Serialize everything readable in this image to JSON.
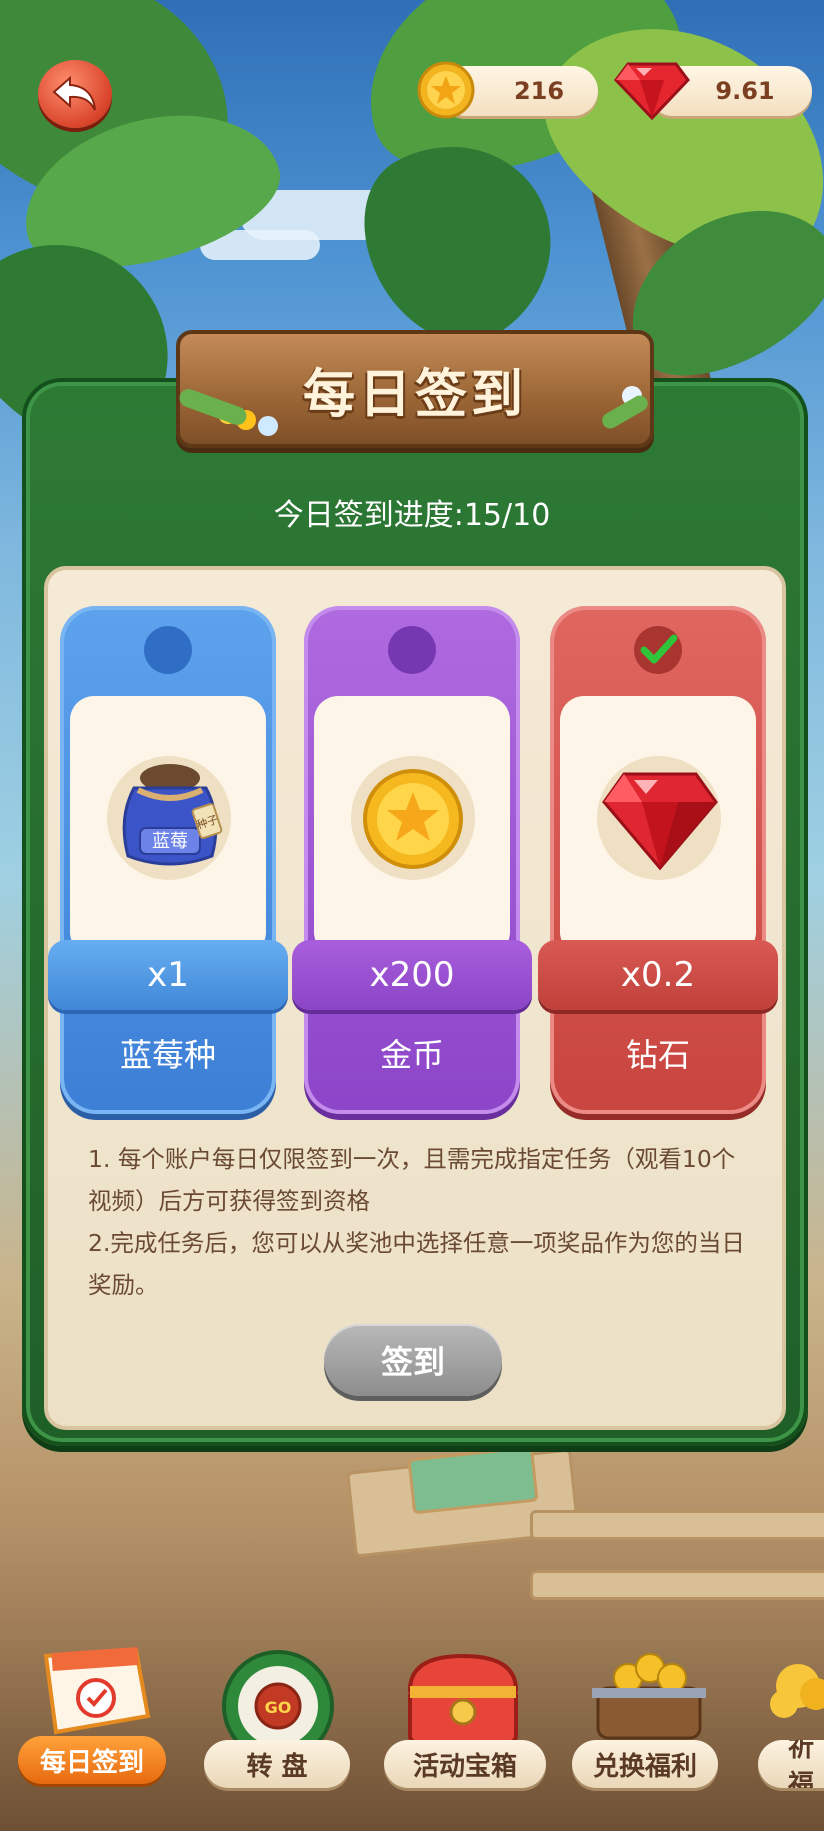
{
  "header": {
    "coins": "216",
    "diamonds": "9.61"
  },
  "panel": {
    "title": "每日签到",
    "progress": "今日签到进度:15/10"
  },
  "rewards": [
    {
      "amount": "x1",
      "name": "蓝莓种",
      "bag_label": "蓝莓",
      "tag": "种子",
      "checked": false,
      "color": "#4a8fe0"
    },
    {
      "amount": "x200",
      "name": "金币",
      "checked": false,
      "color": "#9e57d6"
    },
    {
      "amount": "x0.2",
      "name": "钻石",
      "checked": true,
      "color": "#d4534d"
    }
  ],
  "rules": [
    "1. 每个账户每日仅限签到一次，且需完成指定任务（观看10个视频）后方可获得签到资格",
    "2.完成任务后，您可以从奖池中选择任意一项奖品作为您的当日奖励。"
  ],
  "sign_button": "签到",
  "nav": {
    "items": [
      {
        "label": "每日签到",
        "active": true
      },
      {
        "label": "转 盘",
        "badge": "GO"
      },
      {
        "label": "活动宝箱"
      },
      {
        "label": "兑换福利"
      },
      {
        "label": "祈福"
      }
    ]
  }
}
